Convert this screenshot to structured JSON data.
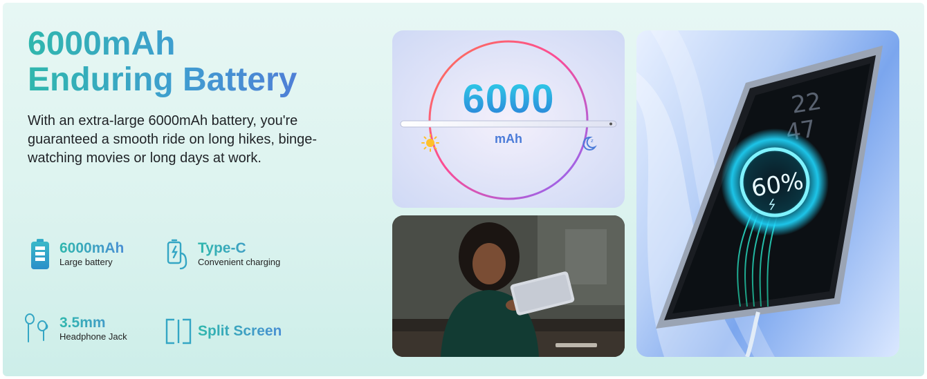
{
  "headline": {
    "line1": "6000mAh",
    "line2": "Enduring Battery"
  },
  "description": "With an extra-large 6000mAh battery, you're guaranteed a smooth ride on long hikes, binge-watching movies or long days at work.",
  "features": [
    {
      "icon": "battery-icon",
      "title": "6000mAh",
      "subtitle": "Large battery"
    },
    {
      "icon": "type-c-charger-icon",
      "title": "Type-C",
      "subtitle": "Convenient charging"
    },
    {
      "icon": "earphones-icon",
      "title": "3.5mm",
      "subtitle": "Headphone Jack"
    },
    {
      "icon": "split-screen-icon",
      "title": "Split Screen",
      "subtitle": ""
    }
  ],
  "panel_battery": {
    "number": "6000",
    "unit": "mAh",
    "day_icon": "sun-icon",
    "night_icon": "moon-icon"
  },
  "panel_tablet": {
    "clock_hour": "22",
    "clock_minute": "47",
    "charge_level": "60%",
    "charge_fraction": 0.6
  },
  "colors": {
    "accent_teal": "#2fb7ad",
    "accent_blue": "#4f7fd6",
    "background": "#dcf3ef"
  }
}
